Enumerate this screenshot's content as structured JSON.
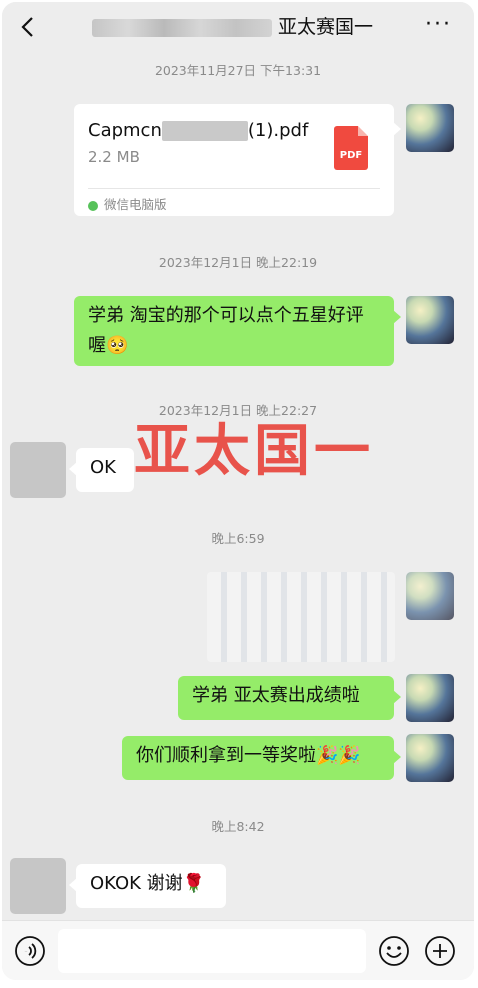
{
  "header": {
    "title": "亚太赛国一",
    "back_icon": "chevron-left-icon",
    "more_label": "···"
  },
  "messages": {
    "ts1": "2023年11月27日 下午13:31",
    "file": {
      "name_prefix": "Capmcn",
      "name_suffix": "(1).pdf",
      "size": "2.2 MB",
      "type_label": "PDF",
      "source": "微信电脑版"
    },
    "ts2": "2023年12月1日 晚上22:19",
    "m1": "学弟 淘宝的那个可以点个五星好评喔🥺",
    "ts3": "2023年12月1日 晚上22:27",
    "m2": "OK",
    "ts4": "晚上6:59",
    "m3": "学弟 亚太赛出成绩啦",
    "m4": "你们顺利拿到一等奖啦🎉🎉",
    "ts5": "晚上8:42",
    "m5": "OKOK 谢谢🌹"
  },
  "watermark": "亚太国一",
  "input_bar": {
    "voice_icon": "voice-icon",
    "emoji_icon": "emoji-icon",
    "plus_icon": "plus-icon"
  },
  "colors": {
    "green_bubble": "#95ec69",
    "background": "#ededed",
    "watermark": "#e8433a"
  }
}
